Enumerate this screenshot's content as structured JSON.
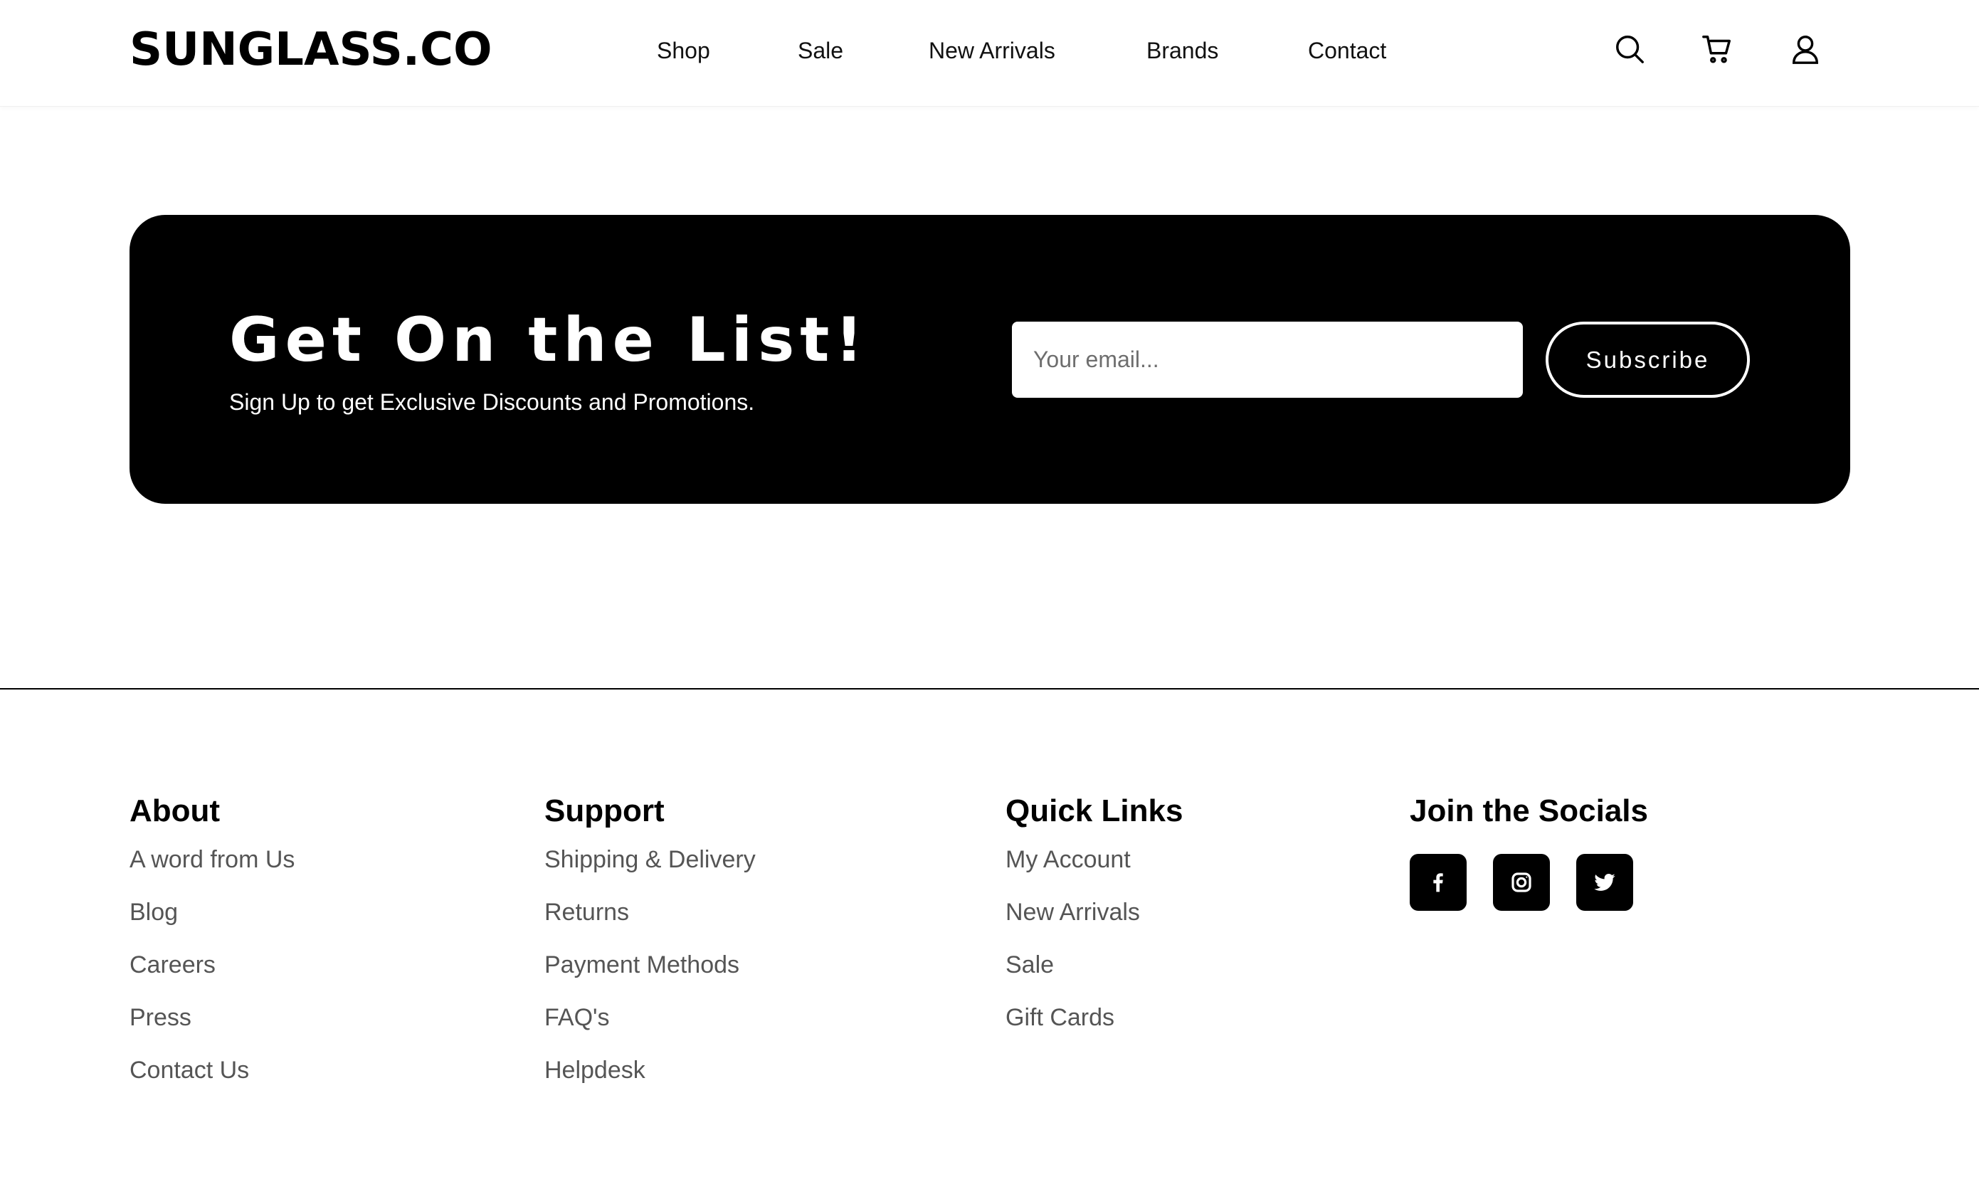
{
  "header": {
    "logo": "SUNGLASS.CO",
    "nav": [
      "Shop",
      "Sale",
      "New Arrivals",
      "Brands",
      "Contact"
    ],
    "icons": [
      "search-icon",
      "cart-icon",
      "user-icon"
    ]
  },
  "newsletter": {
    "title": "Get On the List!",
    "subtitle": "Sign Up to get Exclusive Discounts and Promotions.",
    "email_placeholder": "Your email...",
    "subscribe_label": "Subscribe"
  },
  "footer": {
    "about": {
      "heading": "About",
      "links": [
        "A word from Us",
        "Blog",
        "Careers",
        "Press",
        "Contact Us"
      ]
    },
    "support": {
      "heading": "Support",
      "links": [
        "Shipping & Delivery",
        "Returns",
        "Payment Methods",
        "FAQ's",
        "Helpdesk"
      ]
    },
    "quick_links": {
      "heading": "Quick Links",
      "links": [
        "My Account",
        "New Arrivals",
        "Sale",
        "Gift Cards"
      ]
    },
    "socials": {
      "heading": "Join the Socials",
      "icons": [
        "facebook-icon",
        "instagram-icon",
        "twitter-icon"
      ]
    }
  },
  "colors": {
    "primary": "#000000",
    "background": "#ffffff",
    "link_text": "#555555"
  }
}
